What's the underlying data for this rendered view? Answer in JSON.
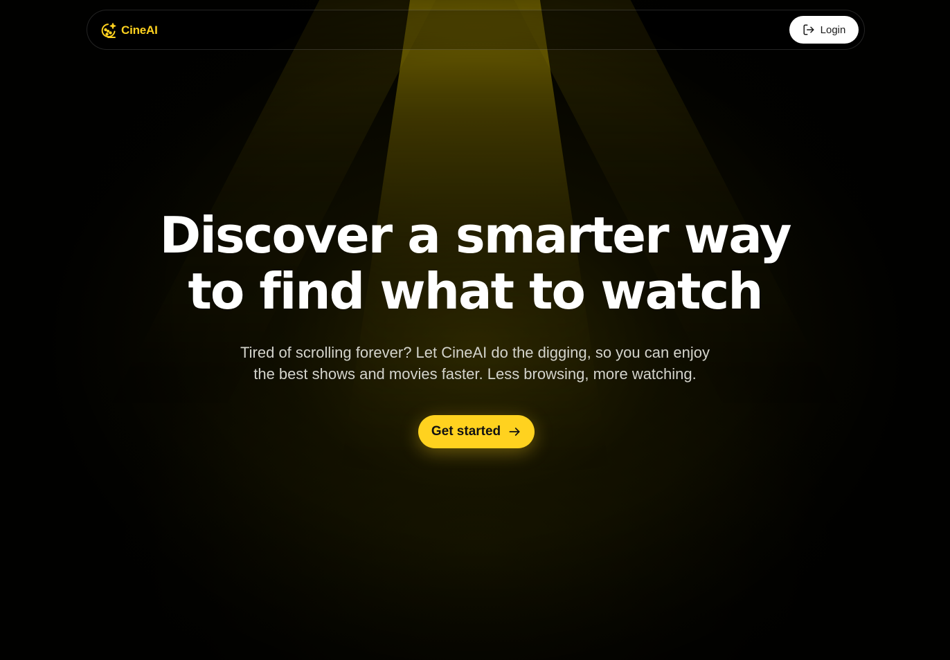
{
  "brand": {
    "name": "CineAI",
    "icon": "film-reel-sparkle-icon",
    "color": "#ffd21f"
  },
  "nav": {
    "login_label": "Login",
    "login_icon": "log-in-icon"
  },
  "hero": {
    "title_line1": "Discover a smarter way",
    "title_line2": "to find what to watch",
    "subtitle_line1": "Tired of scrolling forever? Let CineAI do the digging, so you can enjoy",
    "subtitle_line2": "the best shows and movies faster. Less browsing, more watching.",
    "cta_label": "Get started",
    "cta_icon": "arrow-right-icon"
  },
  "colors": {
    "accent": "#ffd21f",
    "background": "#020200",
    "text": "#ffffff",
    "subtext": "#d4d4cc"
  }
}
